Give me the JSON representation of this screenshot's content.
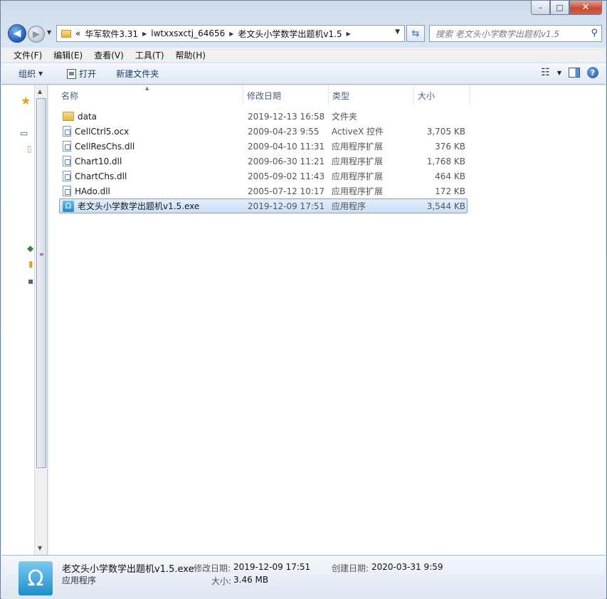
{
  "window": {
    "caption": {
      "minimize": "–",
      "maximize": "□",
      "close": "✕"
    }
  },
  "nav": {
    "back_glyph": "◀",
    "forward_glyph": "▶",
    "breadcrumbs": {
      "overflow": "«",
      "items": [
        "华军软件3.31",
        "lwtxxsxctj_64656",
        "老文头小学数学出题机v1.5"
      ]
    },
    "search_placeholder": "搜索 老文头小学数学出题机v1.5"
  },
  "menu": [
    "文件(F)",
    "编辑(E)",
    "查看(V)",
    "工具(T)",
    "帮助(H)"
  ],
  "toolbar": {
    "organize": "组织",
    "open": "打开",
    "new_folder": "新建文件夹",
    "help": "?"
  },
  "columns": {
    "name": "名称",
    "date": "修改日期",
    "type": "类型",
    "size": "大小"
  },
  "files": [
    {
      "name": "data",
      "date": "2019-12-13 16:58",
      "type": "文件夹",
      "size": "",
      "kind": "folder"
    },
    {
      "name": "CellCtrl5.ocx",
      "date": "2009-04-23 9:55",
      "type": "ActiveX 控件",
      "size": "3,705 KB",
      "kind": "file"
    },
    {
      "name": "CellResChs.dll",
      "date": "2009-04-10 11:31",
      "type": "应用程序扩展",
      "size": "376 KB",
      "kind": "file"
    },
    {
      "name": "Chart10.dll",
      "date": "2009-06-30 11:21",
      "type": "应用程序扩展",
      "size": "1,768 KB",
      "kind": "file"
    },
    {
      "name": "ChartChs.dll",
      "date": "2005-09-02 11:43",
      "type": "应用程序扩展",
      "size": "464 KB",
      "kind": "file"
    },
    {
      "name": "HAdo.dll",
      "date": "2005-07-12 10:17",
      "type": "应用程序扩展",
      "size": "172 KB",
      "kind": "file"
    },
    {
      "name": "老文头小学数学出题机v1.5.exe",
      "date": "2019-12-09 17:51",
      "type": "应用程序",
      "size": "3,544 KB",
      "kind": "exe",
      "selected": true
    }
  ],
  "details": {
    "name": "老文头小学数学出题机v1.5.exe",
    "type": "应用程序",
    "modified_label": "修改日期:",
    "modified_value": "2019-12-09 17:51",
    "created_label": "创建日期:",
    "created_value": "2020-03-31 9:59",
    "size_label": "大小:",
    "size_value": "3.46 MB"
  },
  "colors": {
    "accent": "#2d6cc2",
    "selection": "#cce0f8",
    "selection_border": "#7da2ce"
  }
}
